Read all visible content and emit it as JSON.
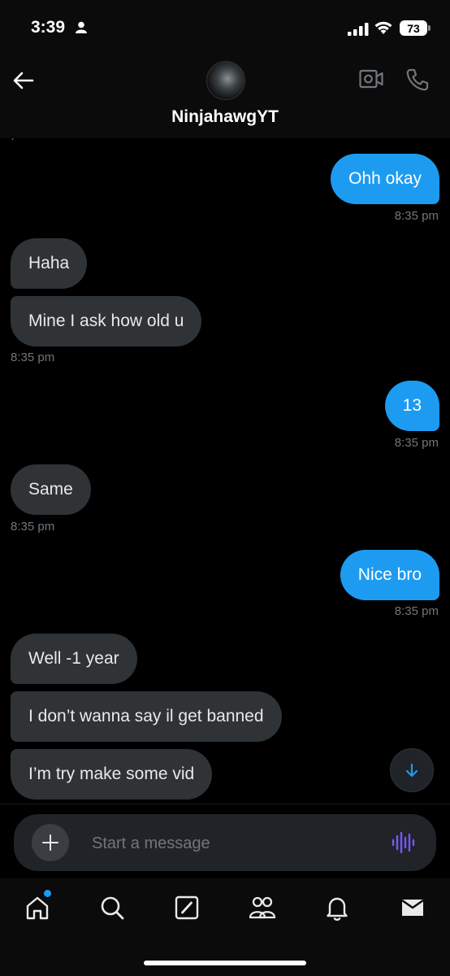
{
  "status_bar": {
    "time": "3:39",
    "battery": "73"
  },
  "header": {
    "contact_name": "NinjahawgYT"
  },
  "messages": [
    {
      "text": "Ohh okay",
      "direction": "sent"
    },
    {
      "text": "Haha",
      "direction": "received"
    },
    {
      "text": "Mine I ask how old u",
      "direction": "received"
    },
    {
      "text": "13",
      "direction": "sent"
    },
    {
      "text": "Same",
      "direction": "received"
    },
    {
      "text": "Nice bro",
      "direction": "sent"
    },
    {
      "text": "Well -1 year",
      "direction": "received"
    },
    {
      "text": "I don’t wanna say il get banned",
      "direction": "received"
    },
    {
      "text": "I’m try make some vid",
      "direction": "received"
    }
  ],
  "timestamps": [
    "8:35 pm",
    "8:35 pm",
    "8:35 pm",
    "8:35 pm",
    "8:35 pm"
  ],
  "composer": {
    "placeholder": "Start a message"
  },
  "nav": {
    "items": [
      "home-icon",
      "search-icon",
      "grok-icon",
      "communities-icon",
      "notifications-icon",
      "messages-icon"
    ]
  },
  "colors": {
    "accent": "#1d9bf0",
    "received_bubble": "#2f3336",
    "background": "#000000",
    "voice_accent": "#7856ff"
  }
}
